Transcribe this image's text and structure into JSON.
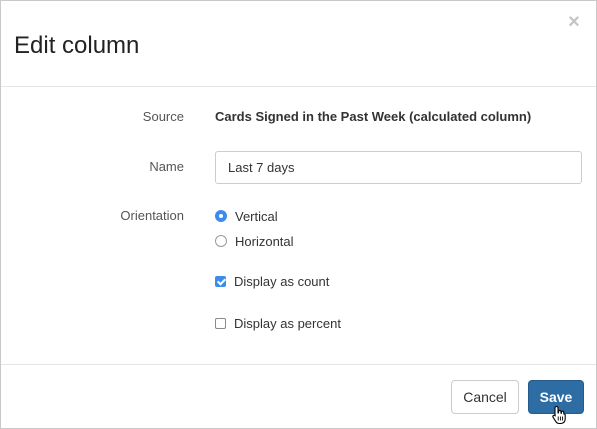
{
  "dialog": {
    "title": "Edit column",
    "close_glyph": "×"
  },
  "form": {
    "source": {
      "label": "Source",
      "value": "Cards Signed in the Past Week (calculated column)"
    },
    "name": {
      "label": "Name",
      "value": "Last 7 days",
      "placeholder": ""
    },
    "orientation": {
      "label": "Orientation",
      "options": [
        {
          "label": "Vertical",
          "checked": true
        },
        {
          "label": "Horizontal",
          "checked": false
        }
      ]
    },
    "display_count": {
      "label": "Display as count",
      "checked": true
    },
    "display_percent": {
      "label": "Display as percent",
      "checked": false
    }
  },
  "footer": {
    "cancel_label": "Cancel",
    "save_label": "Save"
  },
  "colors": {
    "accent": "#3b8ced",
    "primary_button": "#2e6ca4"
  },
  "icons": {
    "close": "close-icon",
    "pointer": "hand-pointer-icon"
  }
}
